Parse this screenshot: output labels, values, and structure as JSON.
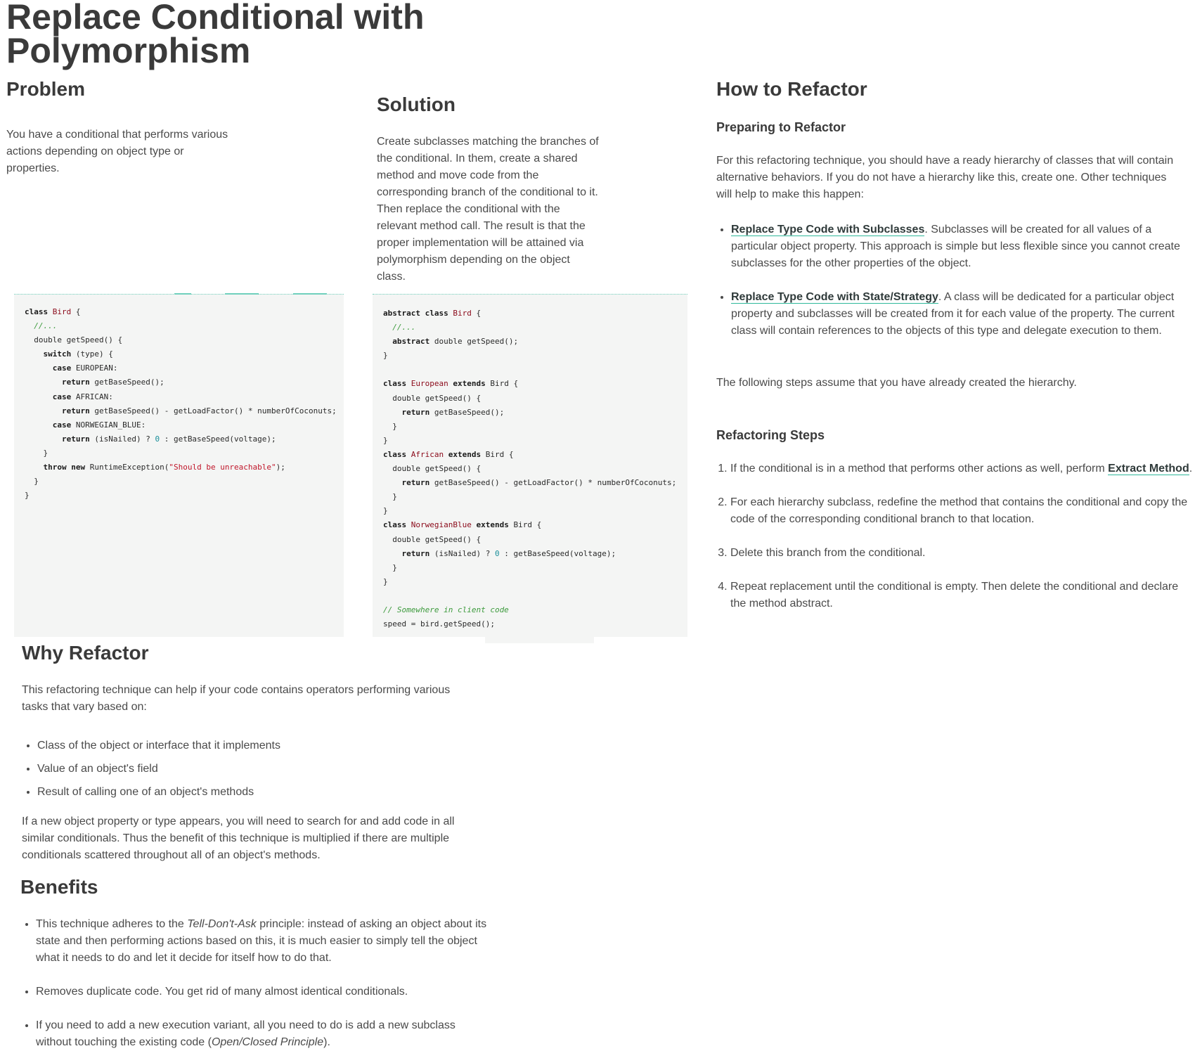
{
  "title": "Replace Conditional with Polymorphism",
  "problem": {
    "heading": "Problem",
    "text": "You have a conditional that performs various actions depending on object type or properties."
  },
  "solution": {
    "heading": "Solution",
    "text": "Create subclasses matching the branches of the conditional. In them, create a shared method and move code from the corresponding branch of the conditional to it. Then replace the conditional with the relevant method call. The result is that the proper implementation will be attained via polymorphism depending on the object class."
  },
  "code_before": [
    "class Bird {",
    "  //...",
    "  double getSpeed() {",
    "    switch (type) {",
    "      case EUROPEAN:",
    "        return getBaseSpeed();",
    "      case AFRICAN:",
    "        return getBaseSpeed() - getLoadFactor() * numberOfCoconuts;",
    "      case NORWEGIAN_BLUE:",
    "        return (isNailed) ? 0 : getBaseSpeed(voltage);",
    "    }",
    "    throw new RuntimeException(\"Should be unreachable\");",
    "  }",
    "}"
  ],
  "code_after": [
    "abstract class Bird {",
    "  //...",
    "  abstract double getSpeed();",
    "}",
    "",
    "class European extends Bird {",
    "  double getSpeed() {",
    "    return getBaseSpeed();",
    "  }",
    "}",
    "class African extends Bird {",
    "  double getSpeed() {",
    "    return getBaseSpeed() - getLoadFactor() * numberOfCoconuts;",
    "  }",
    "}",
    "class NorwegianBlue extends Bird {",
    "  double getSpeed() {",
    "    return (isNailed) ? 0 : getBaseSpeed(voltage);",
    "  }",
    "}",
    "",
    "// Somewhere in client code",
    "speed = bird.getSpeed();"
  ],
  "how_to": {
    "heading": "How to Refactor",
    "preparing_heading": "Preparing to Refactor",
    "preparing_text": "For this refactoring technique, you should have a ready hierarchy of classes that will contain alternative behaviors. If you do not have a hierarchy like this, create one. Other techniques will help to make this happen:",
    "bullets": [
      {
        "link": "Replace Type Code with Subclasses",
        "text": ". Subclasses will be created for all values of a particular object property. This approach is simple but less flexible since you cannot create subclasses for the other properties of the object."
      },
      {
        "link": "Replace Type Code with State/Strategy",
        "text": ". A class will be dedicated for a particular object property and subclasses will be created from it for each value of the property. The current class will contain references to the objects of this type and delegate execution to them."
      }
    ],
    "assume_text": "The following steps assume that you have already created the hierarchy.",
    "steps_heading": "Refactoring Steps",
    "steps": {
      "s1_pre": "If the conditional is in a method that performs other actions as well, perform ",
      "s1_link": "Extract Method",
      "s1_post": ".",
      "s2": "For each hierarchy subclass, redefine the method that contains the conditional and copy the code of the corresponding conditional branch to that location.",
      "s3": "Delete this branch from the conditional.",
      "s4": "Repeat replacement until the conditional is empty. Then delete the conditional and declare the method abstract."
    }
  },
  "why": {
    "heading": "Why Refactor",
    "intro": "This refactoring technique can help if your code contains operators performing various tasks that vary based on:",
    "bullets": [
      "Class of the object or interface that it implements",
      "Value of an object's field",
      "Result of calling one of an object's methods"
    ],
    "outro": "If a new object property or type appears, you will need to search for and add code in all similar conditionals. Thus the benefit of this technique is multiplied if there are multiple conditionals scattered throughout all of an object's methods."
  },
  "benefits": {
    "heading": "Benefits",
    "b1_pre": "This technique adheres to the ",
    "b1_em": "Tell-Don't-Ask",
    "b1_post": " principle: instead of asking an object about its state and then performing actions based on this, it is much easier to simply tell the object what it needs to do and let it decide for itself how to do that.",
    "b2": "Removes duplicate code. You get rid of many almost identical conditionals.",
    "b3_pre": "If you need to add a new execution variant, all you need to do is add a new subclass without touching the existing code (",
    "b3_em": "Open/Closed Principle",
    "b3_post": ")."
  },
  "colors": {
    "text": "#4a4a4a",
    "heading": "#3a3a3a",
    "code_bg": "#f4f5f4",
    "accent_underline": "#2fb89a",
    "keyword_class": "#8b0a1a",
    "comment": "#3c9a3c",
    "string": "#c0162a",
    "number": "#1a8f9a"
  }
}
